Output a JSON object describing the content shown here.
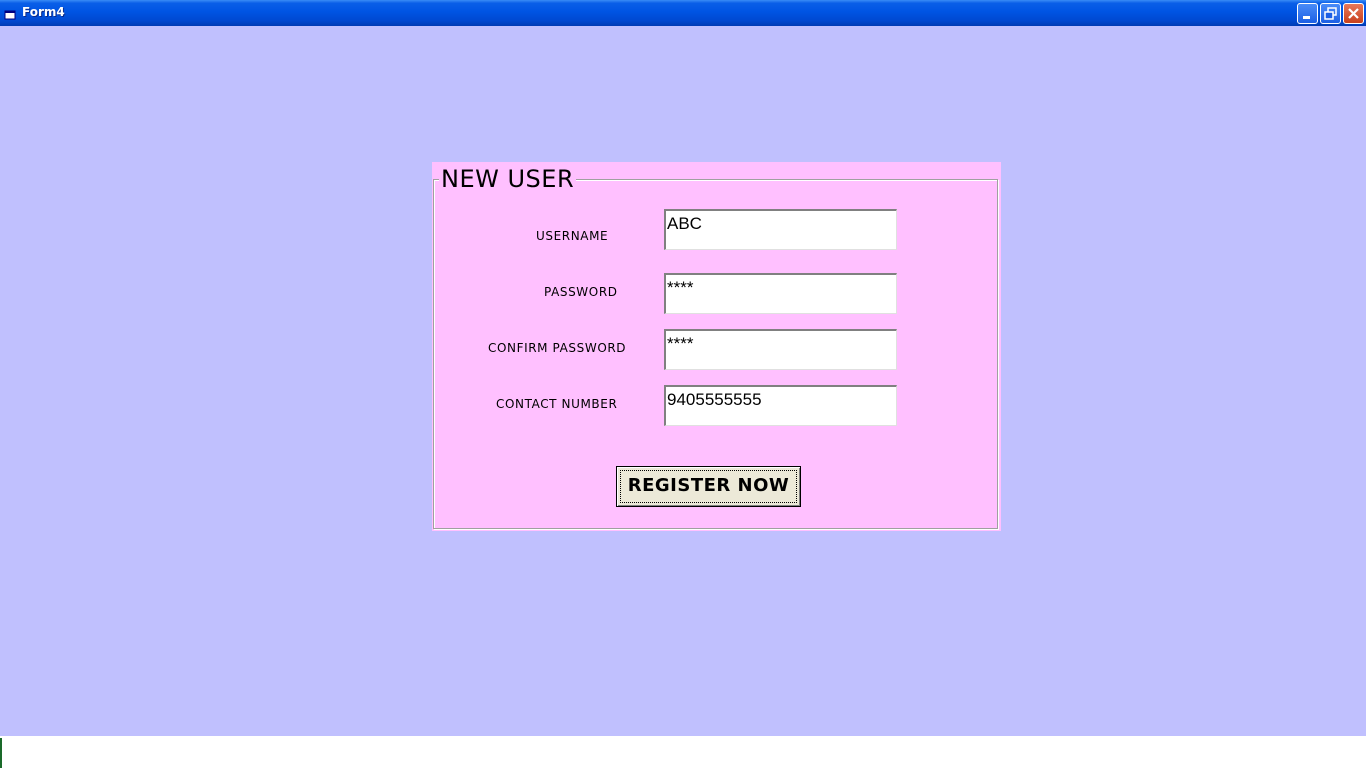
{
  "window": {
    "title": "Form4",
    "icons": {
      "app": "form-app-icon",
      "minimize": "minimize-icon",
      "restore": "restore-icon",
      "close": "close-icon"
    }
  },
  "form": {
    "frame_title": "NEW USER",
    "fields": [
      {
        "label": "USERNAME",
        "value": "ABC"
      },
      {
        "label": "PASSWORD",
        "value": "****"
      },
      {
        "label": "CONFIRM PASSWORD",
        "value": "****"
      },
      {
        "label": "CONTACT NUMBER",
        "value": "9405555555"
      }
    ],
    "register_label": "REGISTER NOW"
  },
  "colors": {
    "form_background": "#c0c0fe",
    "frame_background": "#ffc0ff",
    "titlebar": "#0054e3",
    "button_face": "#ece9d8"
  }
}
